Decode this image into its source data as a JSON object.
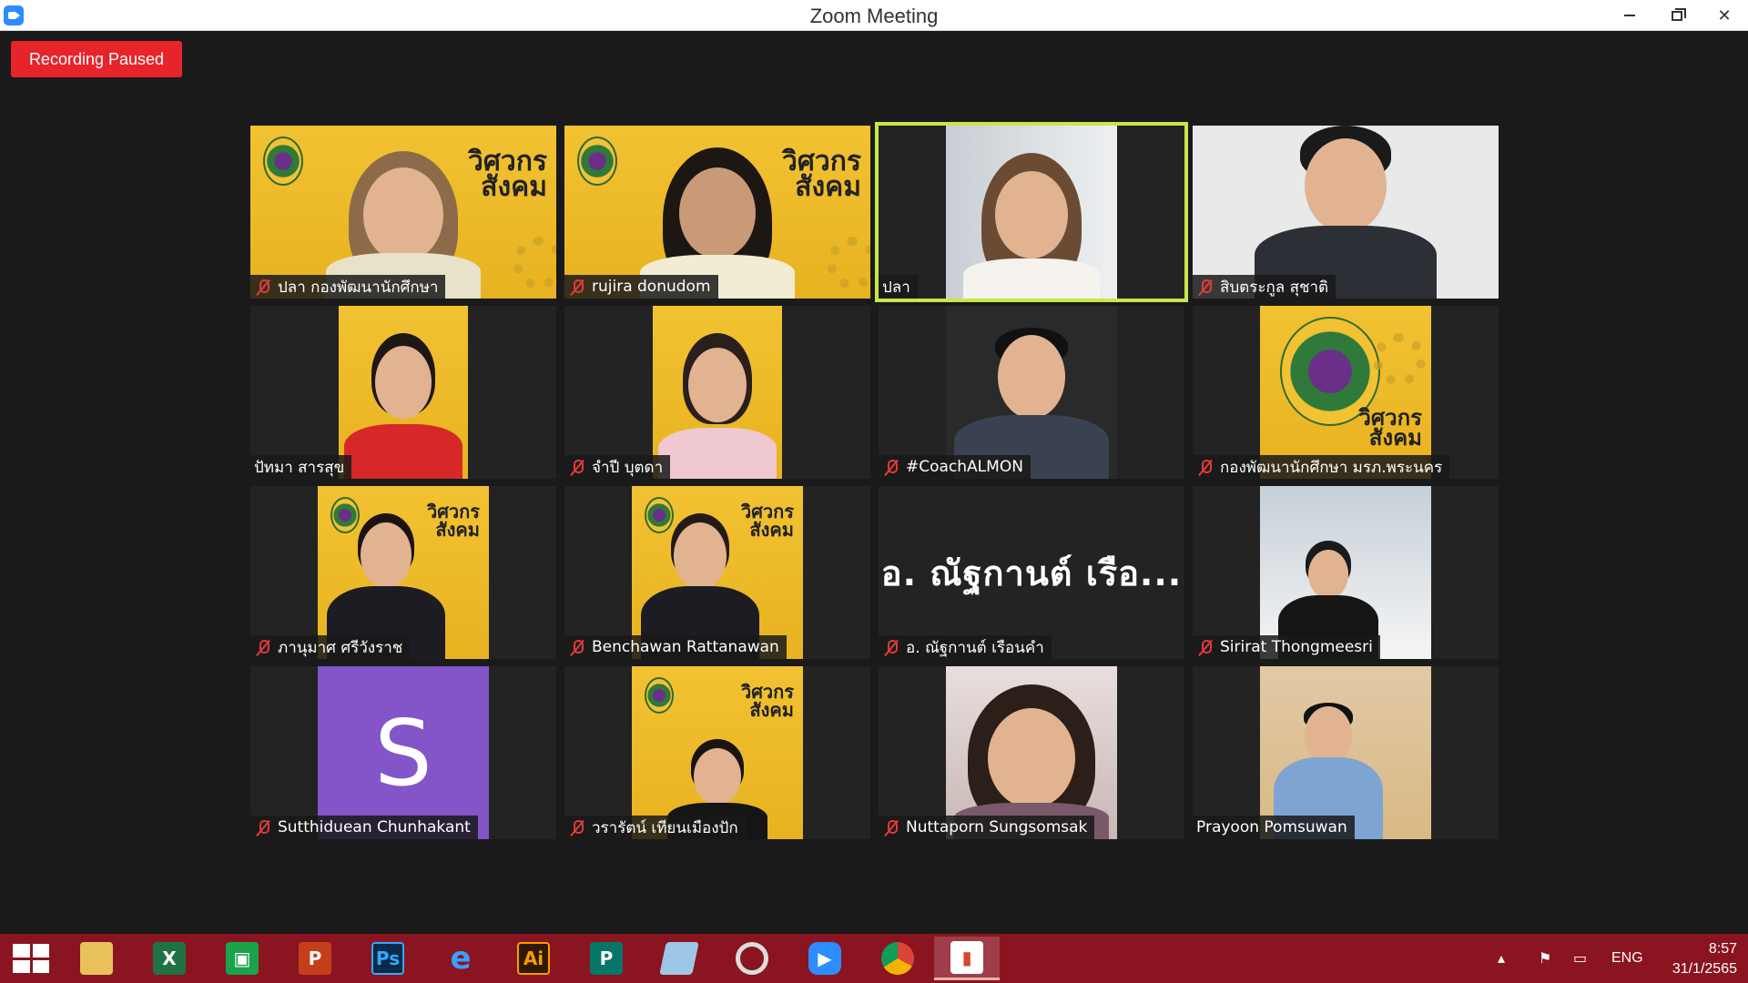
{
  "window": {
    "title": "Zoom Meeting"
  },
  "recording": {
    "status": "Recording Paused"
  },
  "participants": [
    {
      "name": "ปลา กองพัฒนานักศึกษา",
      "muted": true,
      "video": "yellow",
      "active": false
    },
    {
      "name": "rujira donudom",
      "muted": true,
      "video": "yellow",
      "active": false
    },
    {
      "name": "ปลา",
      "muted": false,
      "video": "office",
      "active": true
    },
    {
      "name": "สิบตระกูล สุชาติ",
      "muted": true,
      "video": "light",
      "active": false
    },
    {
      "name": "ปัทมา สารสุข",
      "muted": false,
      "video": "yellow",
      "active": false
    },
    {
      "name": "จำปี บุตดา",
      "muted": true,
      "video": "yellow",
      "active": false
    },
    {
      "name": "#CoachALMON",
      "muted": true,
      "video": "dark",
      "active": false
    },
    {
      "name": "กองพัฒนานักศึกษา มรภ.พระนคร",
      "muted": true,
      "video": "yellow",
      "active": false
    },
    {
      "name": "ภานุมาศ ศรีวังราช",
      "muted": true,
      "video": "yellow",
      "active": false
    },
    {
      "name": "Benchawan Rattanawan",
      "muted": true,
      "video": "yellow",
      "active": false
    },
    {
      "name": "อ. ณัฐกานต์ เรือนคำ",
      "muted": true,
      "video": "none",
      "display_name": "อ. ณัฐกานต์ เรือ...",
      "active": false
    },
    {
      "name": "Sirirat Thongmeesri",
      "muted": true,
      "video": "snow",
      "active": false
    },
    {
      "name": "Sutthiduean Chunhakant",
      "muted": true,
      "video": "avatar",
      "avatar_letter": "S",
      "active": false
    },
    {
      "name": "วรารัตน์ เทียนเมืองปัก",
      "muted": true,
      "video": "yellow",
      "active": false
    },
    {
      "name": "Nuttaporn Sungsomsak",
      "muted": true,
      "video": "pink",
      "active": false
    },
    {
      "name": "Prayoon Pomsuwan",
      "muted": false,
      "video": "hall",
      "active": false
    }
  ],
  "brand": {
    "line1": "วิศวกร",
    "line2": "สังคม"
  },
  "taskbar": {
    "apps": [
      {
        "name": "file-explorer",
        "label": ""
      },
      {
        "name": "excel",
        "label": "X"
      },
      {
        "name": "store",
        "label": ""
      },
      {
        "name": "powerpoint",
        "label": "P"
      },
      {
        "name": "photoshop",
        "label": "Ps"
      },
      {
        "name": "internet-explorer",
        "label": "e"
      },
      {
        "name": "illustrator",
        "label": "Ai"
      },
      {
        "name": "publisher",
        "label": "P"
      },
      {
        "name": "notepad",
        "label": ""
      },
      {
        "name": "photoscape",
        "label": ""
      },
      {
        "name": "zoom",
        "label": ""
      },
      {
        "name": "chrome",
        "label": ""
      },
      {
        "name": "photos",
        "label": ""
      }
    ],
    "language": "ENG",
    "time": "8:57",
    "date": "31/1/2565"
  },
  "colors": {
    "accent_active": "#c8e64a",
    "recording": "#e8242b",
    "taskbar": "#8a1420",
    "muted_mic": "#e23a3a"
  }
}
